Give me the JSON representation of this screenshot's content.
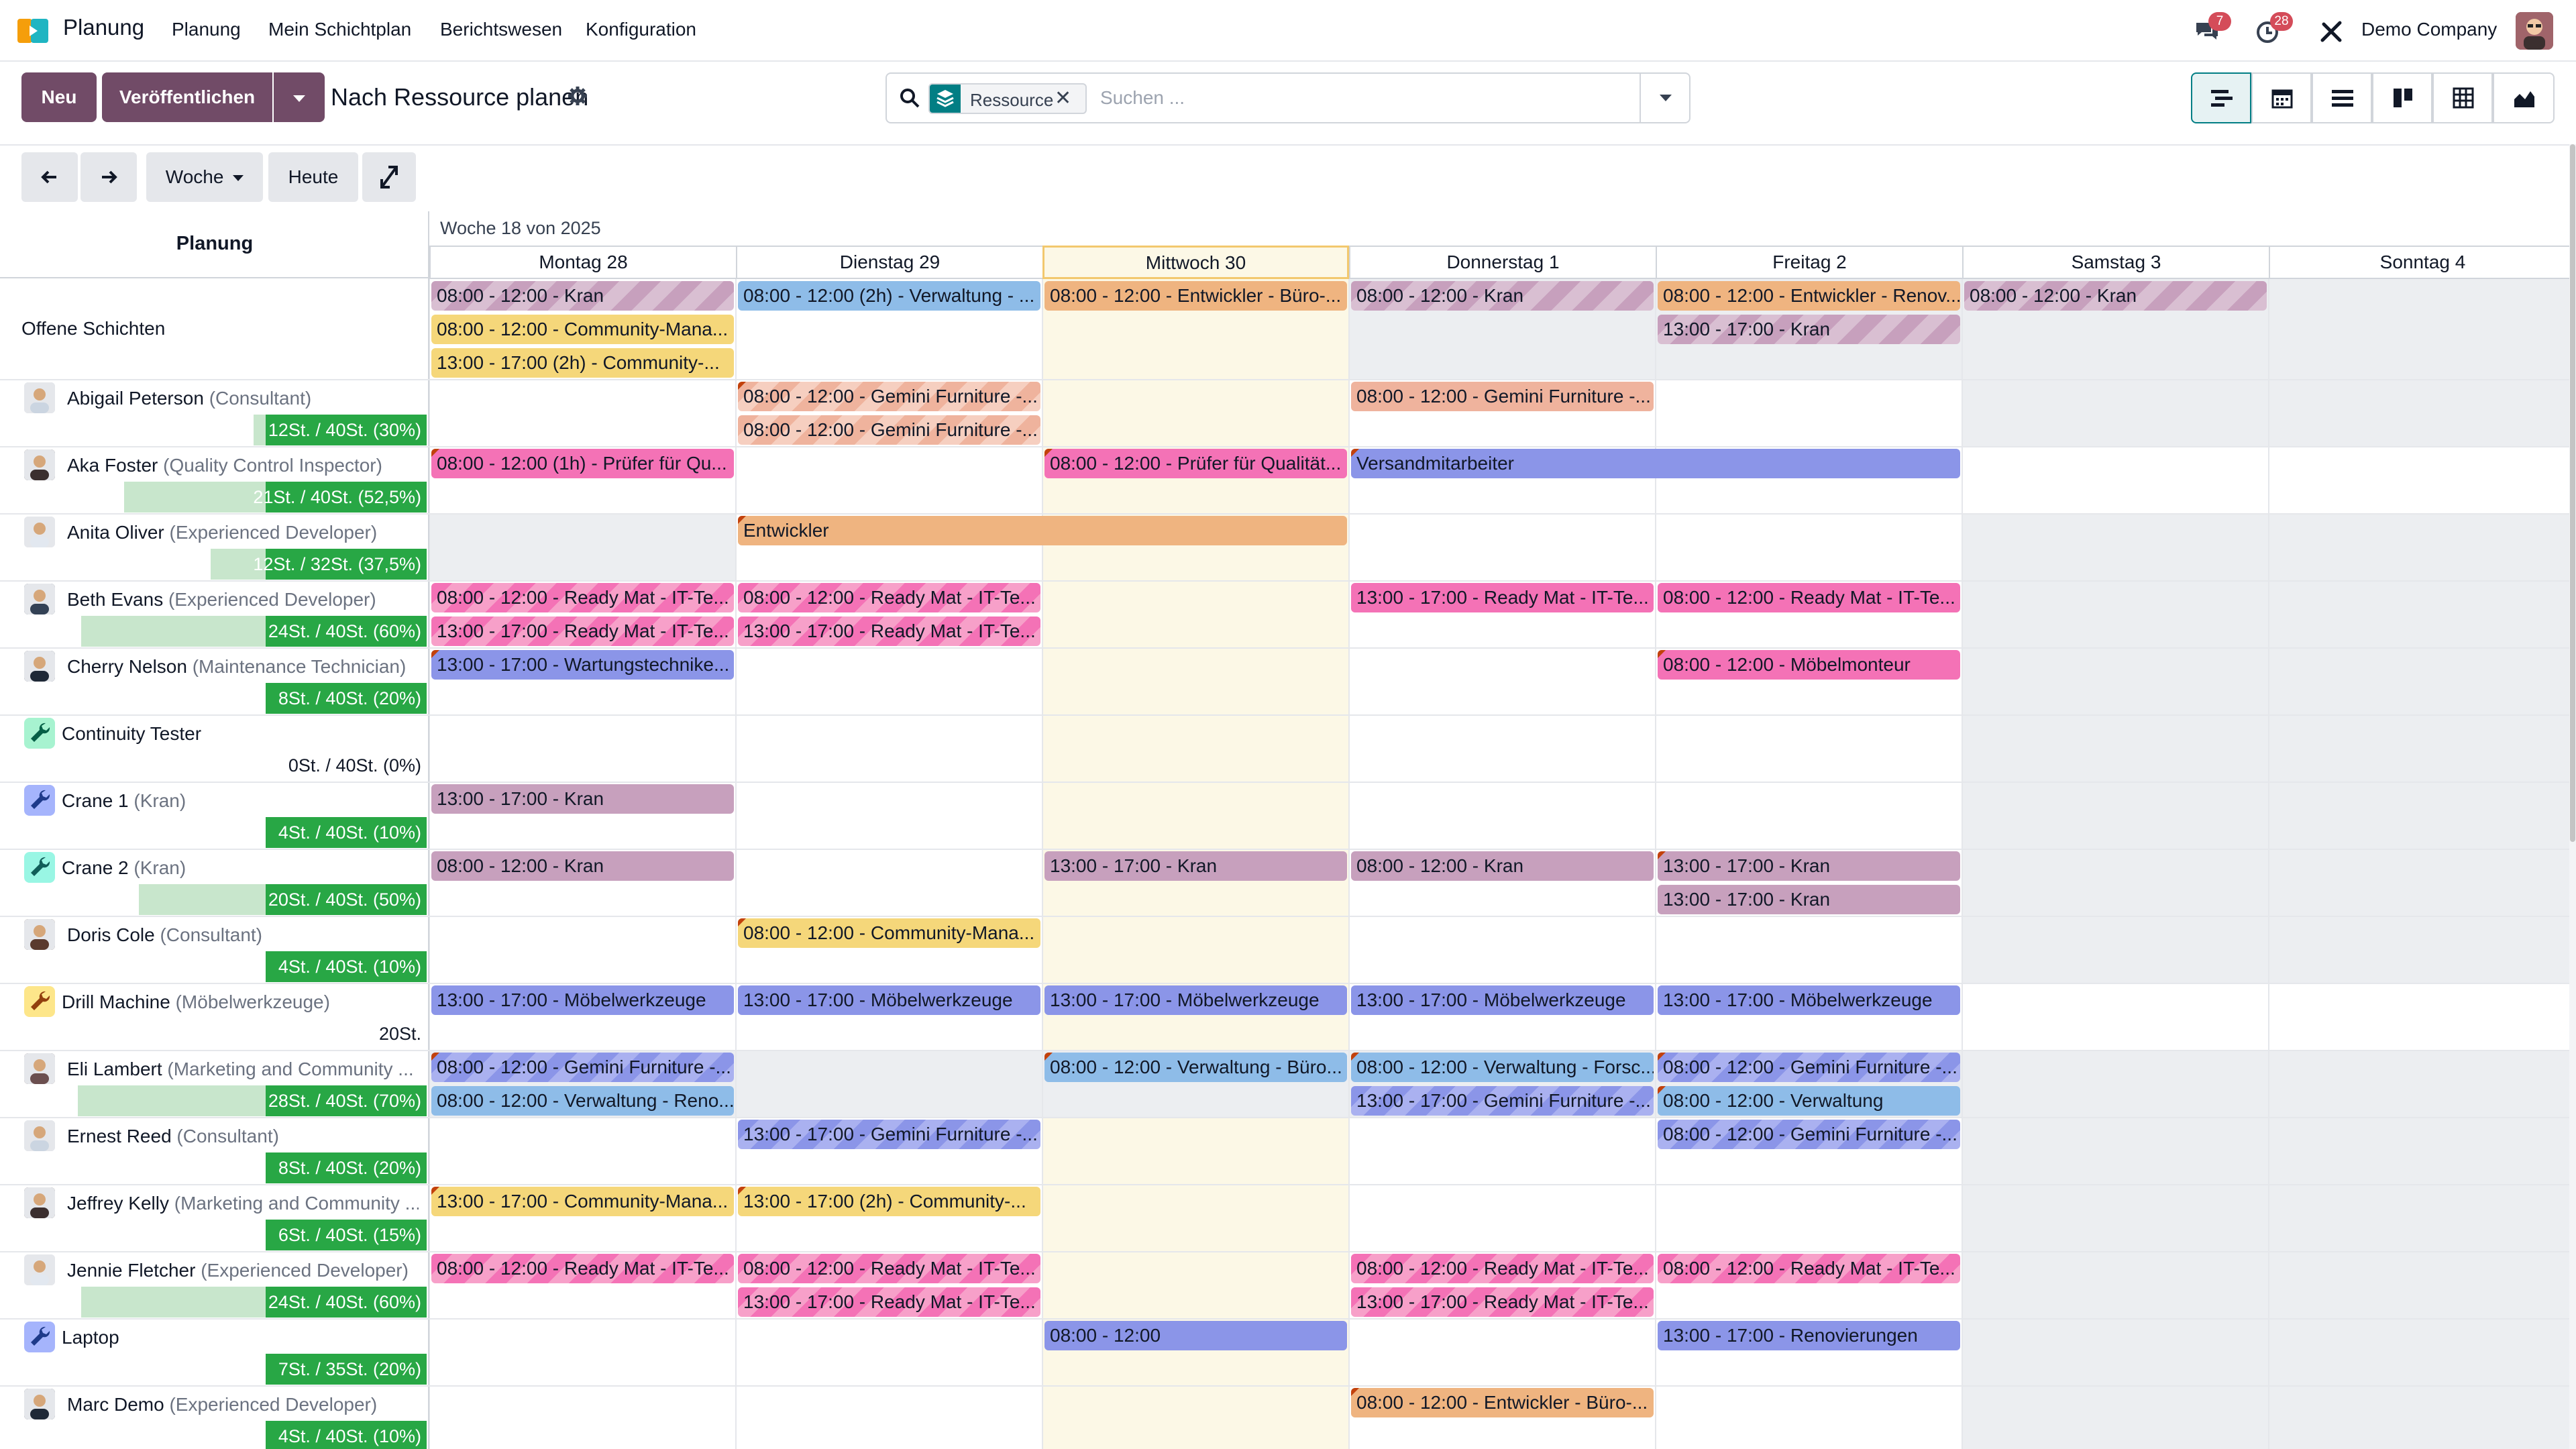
{
  "app": {
    "brand": "Planung"
  },
  "nav": {
    "items": [
      "Planung",
      "Mein Schichtplan",
      "Berichtswesen",
      "Konfiguration"
    ],
    "messages_count": "7",
    "activity_count": "28",
    "company": "Demo Company"
  },
  "toolbar": {
    "new_label": "Neu",
    "publish_label": "Veröffentlichen",
    "title": "Nach Ressource planen",
    "facet_label": "Ressource",
    "search_placeholder": "Suchen ...",
    "period_label": "Woche",
    "today_label": "Heute"
  },
  "gantt": {
    "left_header": "Planung",
    "week_label": "Woche 18 von 2025",
    "days": [
      "Montag 28",
      "Dienstag 29",
      "Mittwoch 30",
      "Donnerstag 1",
      "Freitag 2",
      "Samstag 3",
      "Sonntag 4"
    ],
    "rows": [
      {
        "name": "Offene Schichten",
        "role": "",
        "progress": ""
      },
      {
        "name": "Abigail Peterson",
        "role": "(Consultant)",
        "progress": "12St. / 40St. (30%)",
        "pct": 30
      },
      {
        "name": "Aka Foster",
        "role": "(Quality Control Inspector)",
        "progress": "21St. / 40St. (52,5%)",
        "pct": 52.5
      },
      {
        "name": "Anita Oliver",
        "role": "(Experienced Developer)",
        "progress": "12St. / 32St. (37,5%)",
        "pct": 37.5
      },
      {
        "name": "Beth Evans",
        "role": "(Experienced Developer)",
        "progress": "24St. / 40St. (60%)",
        "pct": 60
      },
      {
        "name": "Cherry Nelson",
        "role": "(Maintenance Technician)",
        "progress": "8St. / 40St. (20%)",
        "pct": 20
      },
      {
        "name": "Continuity Tester",
        "role": "",
        "progress": "0St. / 40St. (0%)",
        "pct": 0
      },
      {
        "name": "Crane 1",
        "role": "(Kran)",
        "progress": "4St. / 40St. (10%)",
        "pct": 10
      },
      {
        "name": "Crane 2",
        "role": "(Kran)",
        "progress": "20St. / 40St. (50%)",
        "pct": 50
      },
      {
        "name": "Doris Cole",
        "role": "(Consultant)",
        "progress": "4St. / 40St. (10%)",
        "pct": 10
      },
      {
        "name": "Drill Machine",
        "role": "(Möbelwerkzeuge)",
        "progress": "20St.",
        "pct": 0
      },
      {
        "name": "Eli Lambert",
        "role": "(Marketing and Community ...",
        "progress": "28St. / 40St. (70%)",
        "pct": 70
      },
      {
        "name": "Ernest Reed",
        "role": "(Consultant)",
        "progress": "8St. / 40St. (20%)",
        "pct": 20
      },
      {
        "name": "Jeffrey Kelly",
        "role": "(Marketing and Community ...",
        "progress": "6St. / 40St. (15%)",
        "pct": 15
      },
      {
        "name": "Jennie Fletcher",
        "role": "(Experienced Developer)",
        "progress": "24St. / 40St. (60%)",
        "pct": 60
      },
      {
        "name": "Laptop",
        "role": "",
        "progress": "7St. / 35St. (20%)",
        "pct": 20
      },
      {
        "name": "Marc Demo",
        "role": "(Experienced Developer)",
        "progress": "4St. / 40St. (10%)",
        "pct": 10
      }
    ],
    "pills": {
      "p0": "08:00 - 12:00 - Kran",
      "p1": "08:00 - 12:00 (2h) - Verwaltung - ...",
      "p2": "08:00 - 12:00 - Entwickler - Büro-...",
      "p3": "08:00 - 12:00 - Kran",
      "p4": "08:00 - 12:00 - Entwickler - Renov...",
      "p5": "08:00 - 12:00 - Kran",
      "p6": "08:00 - 12:00 - Community-Mana...",
      "p7": "13:00 - 17:00 - Kran",
      "p8": "13:00 - 17:00 (2h) - Community-...",
      "p9": "08:00 - 12:00 - Gemini Furniture -...",
      "p10": "08:00 - 12:00 - Gemini Furniture -...",
      "p11": "08:00 - 12:00 - Gemini Furniture -...",
      "p12": "08:00 - 12:00 (1h) - Prüfer für Qu...",
      "p13": "08:00 - 12:00 - Prüfer für Qualität...",
      "p14": "Versandmitarbeiter",
      "p15": "Entwickler",
      "p16": "08:00 - 12:00 - Ready Mat - IT-Te...",
      "p17": "08:00 - 12:00 - Ready Mat - IT-Te...",
      "p18": "13:00 - 17:00 - Ready Mat - IT-Te...",
      "p19": "08:00 - 12:00 - Ready Mat - IT-Te...",
      "p20": "13:00 - 17:00 - Ready Mat - IT-Te...",
      "p21": "13:00 - 17:00 - Ready Mat - IT-Te...",
      "p22": "13:00 - 17:00 - Wartungstechnike...",
      "p23": "08:00 - 12:00 - Möbelmonteur",
      "p24": "13:00 - 17:00 - Kran",
      "p25": "08:00 - 12:00 - Kran",
      "p26": "13:00 - 17:00 - Kran",
      "p27": "08:00 - 12:00 - Kran",
      "p28": "13:00 - 17:00 - Kran",
      "p29": "13:00 - 17:00 - Kran",
      "p30": "08:00 - 12:00 - Community-Mana...",
      "p31": "13:00 - 17:00 - Möbelwerkzeuge",
      "p32": "13:00 - 17:00 - Möbelwerkzeuge",
      "p33": "13:00 - 17:00 - Möbelwerkzeuge",
      "p34": "13:00 - 17:00 - Möbelwerkzeuge",
      "p35": "13:00 - 17:00 - Möbelwerkzeuge",
      "p36": "08:00 - 12:00 - Gemini Furniture -...",
      "p37": "08:00 - 12:00 - Verwaltung - Reno...",
      "p38": "08:00 - 12:00 - Verwaltung - Büro...",
      "p39": "08:00 - 12:00 - Verwaltung - Forsc...",
      "p40": "13:00 - 17:00 - Gemini Furniture -...",
      "p41": "08:00 - 12:00 - Gemini Furniture -...",
      "p42": "08:00 - 12:00 - Verwaltung",
      "p43": "13:00 - 17:00 - Gemini Furniture -...",
      "p44": "08:00 - 12:00 - Gemini Furniture -...",
      "p45": "13:00 - 17:00 - Community-Mana...",
      "p46": "13:00 - 17:00 (2h) - Community-...",
      "p47": "08:00 - 12:00 - Ready Mat - IT-Te...",
      "p48": "08:00 - 12:00 - Ready Mat - IT-Te...",
      "p49": "13:00 - 17:00 - Ready Mat - IT-Te...",
      "p50": "08:00 - 12:00 - Ready Mat - IT-Te...",
      "p51": "13:00 - 17:00 - Ready Mat - IT-Te...",
      "p52": "08:00 - 12:00 - Ready Mat - IT-Te...",
      "p53": "08:00 - 12:00",
      "p54": "13:00 - 17:00 - Renovierungen",
      "p55": "08:00 - 12:00 - Entwickler - Büro-..."
    }
  },
  "colors": {
    "primary": "#714b67",
    "teal": "#017e84",
    "success": "#28a745",
    "today": "#fcf8e6"
  }
}
